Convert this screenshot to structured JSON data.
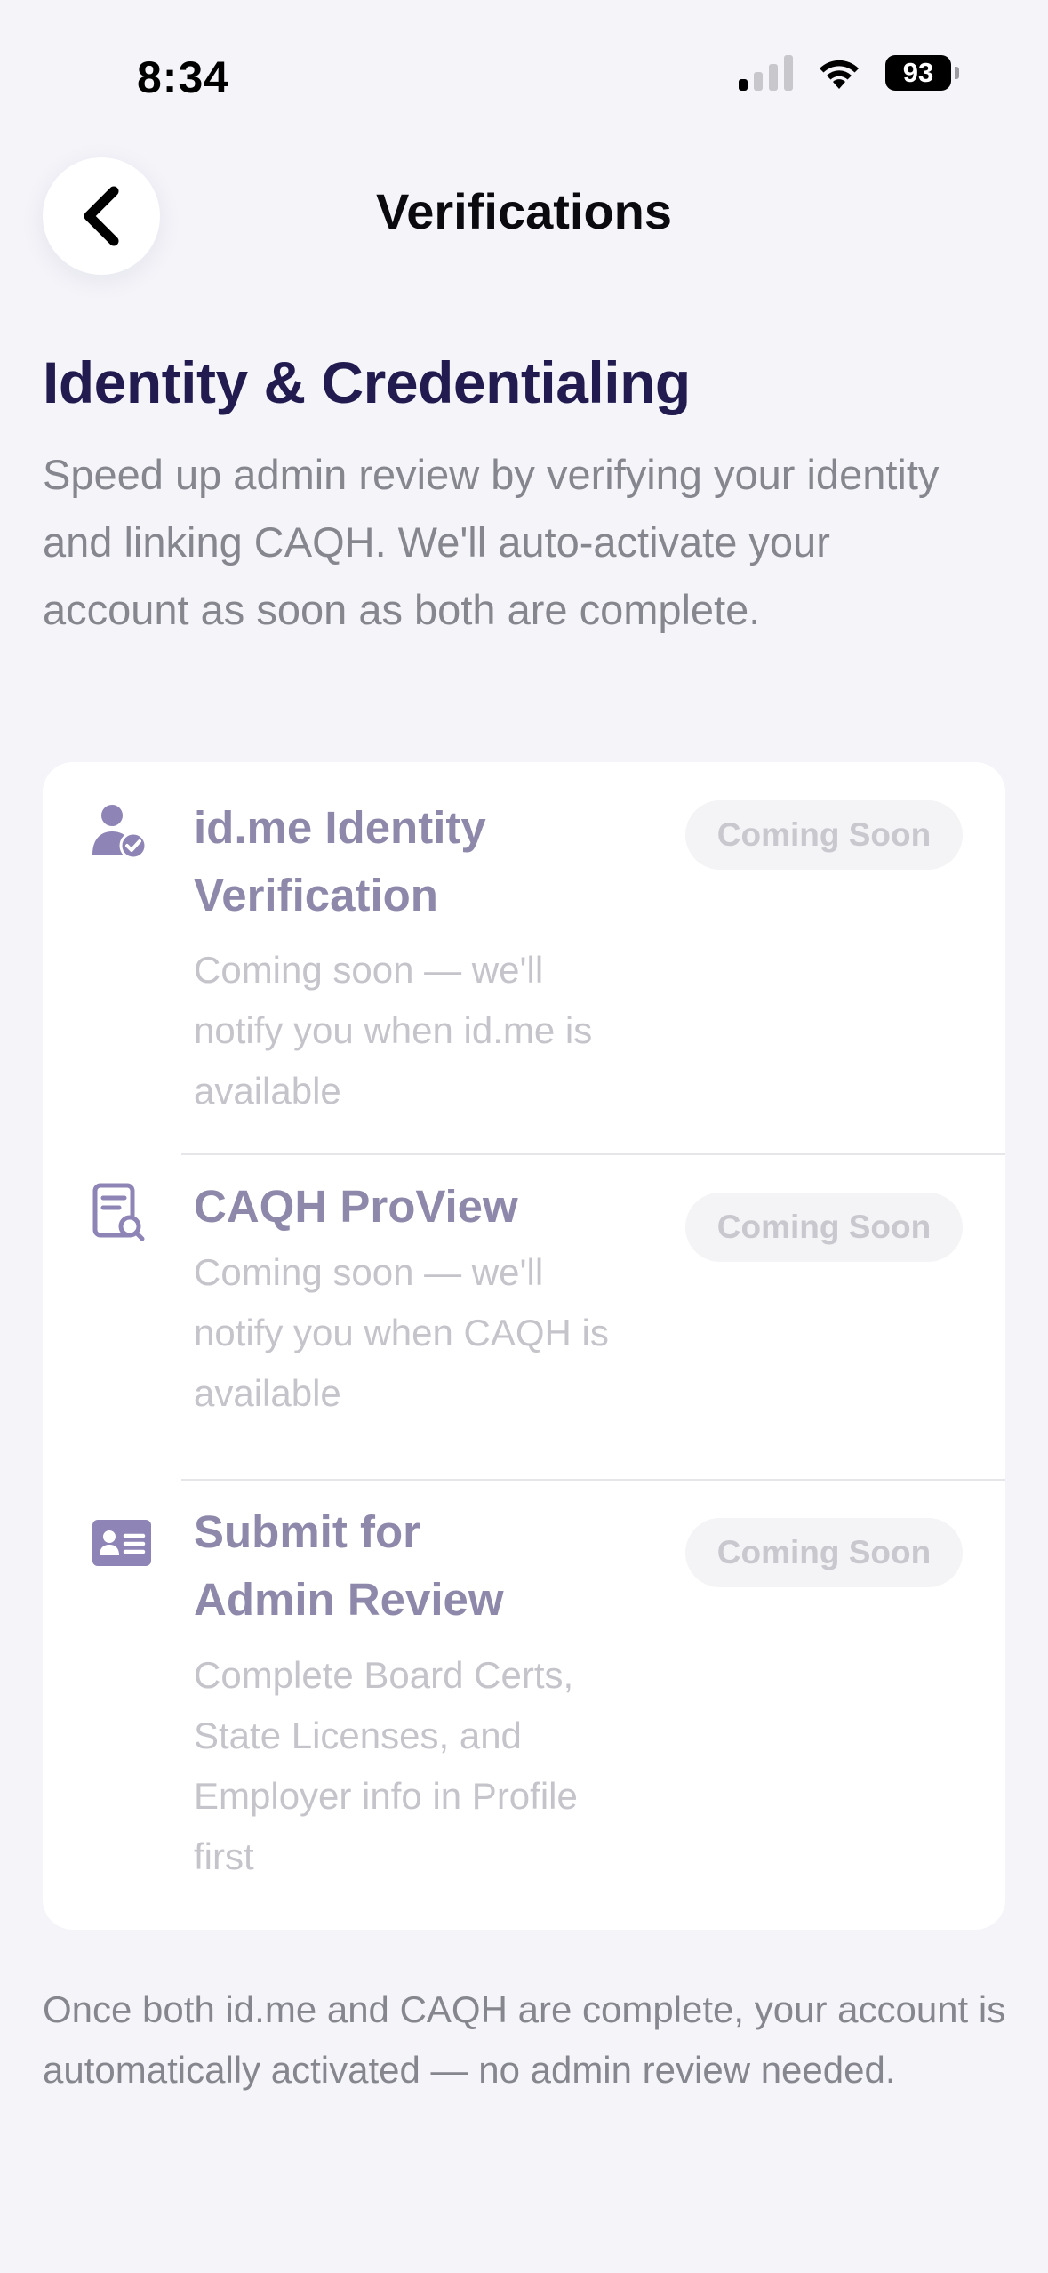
{
  "status_bar": {
    "time": "8:34",
    "battery": "93",
    "icons": [
      "cellular-signal-icon",
      "wifi-icon",
      "battery-icon"
    ]
  },
  "header": {
    "title": "Verifications",
    "back_icon": "chevron-left-icon"
  },
  "section": {
    "title": "Identity & Credentialing",
    "description": "Speed up admin review by verifying your identity and linking CAQH. We'll auto-activate your account as soon as both are complete."
  },
  "items": [
    {
      "icon": "person-check-icon",
      "title": "id.me Identity Verification",
      "subtitle": "Coming soon — we'll notify you when id.me is available",
      "badge": "Coming Soon"
    },
    {
      "icon": "document-search-icon",
      "title": "CAQH ProView",
      "subtitle": "Coming soon — we'll notify you when CAQH is available",
      "badge": "Coming Soon"
    },
    {
      "icon": "id-card-icon",
      "title": "Submit for Admin Review",
      "subtitle": "Complete Board Certs, State Licenses, and Employer info in Profile first",
      "badge": "Coming Soon"
    }
  ],
  "footer_note": "Once both id.me and CAQH are complete, your account is automatically activated — no admin review needed.",
  "colors": {
    "background": "#F4F4F9",
    "heading": "#221B4F",
    "icon_accent": "#8E84B5",
    "muted_text": "#86868E"
  }
}
